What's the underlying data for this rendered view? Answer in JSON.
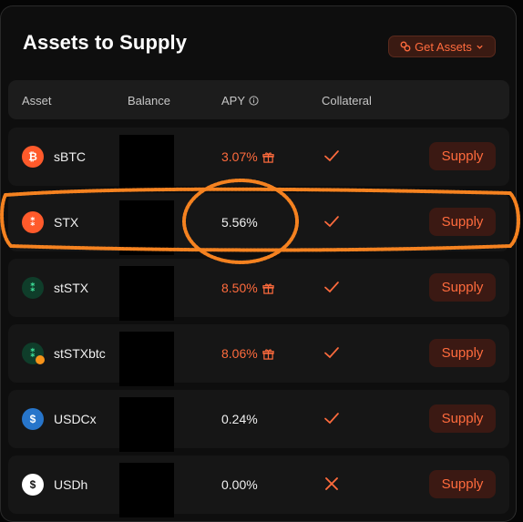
{
  "header": {
    "title": "Assets to Supply",
    "get_assets_label": "Get Assets"
  },
  "table": {
    "columns": {
      "asset": "Asset",
      "balance": "Balance",
      "apy": "APY",
      "collateral": "Collateral"
    },
    "rows": [
      {
        "asset": "sBTC",
        "apy": "3.07%",
        "apy_style": "incentive",
        "collateral": "check",
        "action": "Supply"
      },
      {
        "asset": "STX",
        "apy": "5.56%",
        "apy_style": "plain",
        "collateral": "check",
        "action": "Supply"
      },
      {
        "asset": "stSTX",
        "apy": "8.50%",
        "apy_style": "incentive",
        "collateral": "check",
        "action": "Supply"
      },
      {
        "asset": "stSTXbtc",
        "apy": "8.06%",
        "apy_style": "incentive",
        "collateral": "check",
        "action": "Supply"
      },
      {
        "asset": "USDCx",
        "apy": "0.24%",
        "apy_style": "plain",
        "collateral": "check",
        "action": "Supply"
      },
      {
        "asset": "USDh",
        "apy": "0.00%",
        "apy_style": "plain",
        "collateral": "cross",
        "action": "Supply"
      }
    ]
  },
  "colors": {
    "accent": "#ff6b3d",
    "button_bg": "#3b1913",
    "row_bg": "#161616",
    "highlight_marker": "#f58220"
  },
  "icons": {
    "get_assets": "link-icon",
    "dropdown": "chevron-down-icon",
    "apy_info": "info-icon",
    "incentive": "gift-icon"
  }
}
